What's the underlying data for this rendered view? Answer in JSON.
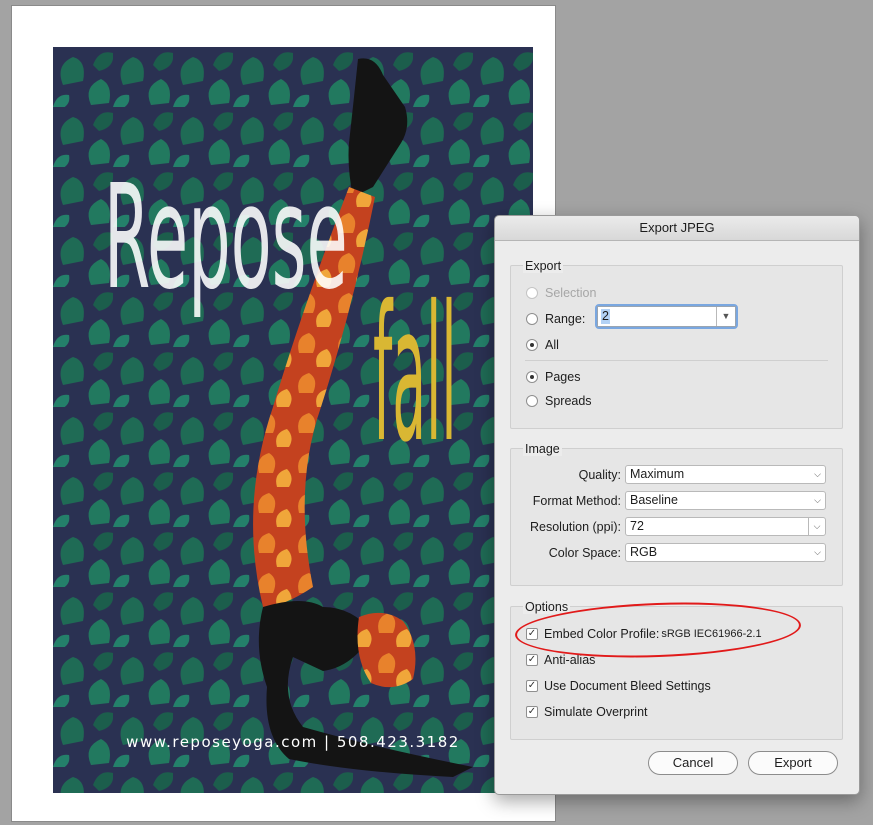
{
  "poster": {
    "title_word1": "Repose",
    "title_word2": "fall",
    "footer": "www.reposeyoga.com | 508.423.3182",
    "colors": {
      "background": "#2a3152",
      "leaf": "#1f6b55",
      "accent": "#d9b733",
      "legs": "#c4421f"
    }
  },
  "dialog": {
    "title": "Export JPEG",
    "export_group": {
      "label": "Export",
      "selection_label": "Selection",
      "range_label": "Range:",
      "range_value": "2",
      "all_label": "All",
      "pages_label": "Pages",
      "spreads_label": "Spreads"
    },
    "image_group": {
      "label": "Image",
      "quality_label": "Quality:",
      "quality_value": "Maximum",
      "format_label": "Format Method:",
      "format_value": "Baseline",
      "resolution_label": "Resolution (ppi):",
      "resolution_value": "72",
      "colorspace_label": "Color Space:",
      "colorspace_value": "RGB"
    },
    "options_group": {
      "label": "Options",
      "embed_label": "Embed Color Profile:",
      "embed_value": "sRGB IEC61966-2.1",
      "antialias_label": "Anti-alias",
      "bleed_label": "Use Document Bleed Settings",
      "overprint_label": "Simulate Overprint"
    },
    "cancel_label": "Cancel",
    "export_label": "Export"
  },
  "annotation_color": "#e11a1a"
}
